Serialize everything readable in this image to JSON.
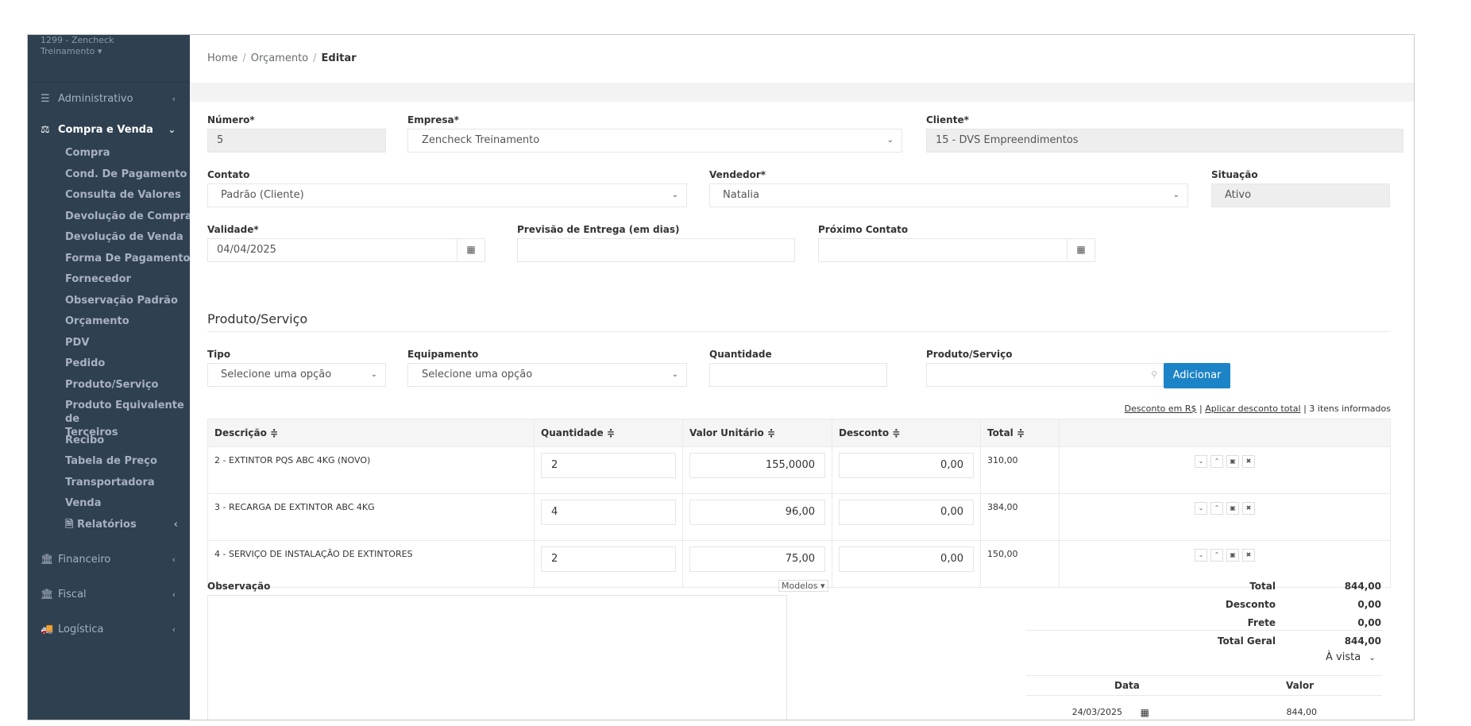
{
  "sidebar": {
    "user_line1": "1299 - Zencheck",
    "user_line2": "Treinamento ▾",
    "sections": {
      "administrativo": "Administrativo",
      "compra_venda": "Compra e Venda",
      "financeiro": "Financeiro",
      "fiscal": "Fiscal",
      "logistica": "Logística"
    },
    "items": [
      "Compra",
      "Cond. De Pagamento",
      "Consulta de Valores",
      "Devolução de Compra",
      "Devolução de Venda",
      "Forma De Pagamento",
      "Fornecedor",
      "Observação Padrão",
      "Orçamento",
      "PDV",
      "Pedido",
      "Produto/Serviço",
      "Produto Equivalente de",
      "Terceiros",
      "Recibo",
      "Tabela de Preço",
      "Transportadora",
      "Venda"
    ],
    "relatorios": "Relatórios"
  },
  "breadcrumb": {
    "home": "Home",
    "orcamento": "Orçamento",
    "editar": "Editar"
  },
  "form": {
    "numero_label": "Número*",
    "numero_value": "5",
    "empresa_label": "Empresa*",
    "empresa_value": "Zencheck Treinamento",
    "cliente_label": "Cliente*",
    "cliente_value": "15 - DVS Empreendimentos",
    "contato_label": "Contato",
    "contato_value": "Padrão (Cliente)",
    "vendedor_label": "Vendedor*",
    "vendedor_value": "Natalia",
    "situacao_label": "Situação",
    "situacao_value": "Ativo",
    "validade_label": "Validade*",
    "validade_value": "04/04/2025",
    "previsao_label": "Previsão de Entrega (em dias)",
    "proximo_label": "Próximo Contato"
  },
  "produto": {
    "title": "Produto/Serviço",
    "tipo_label": "Tipo",
    "tipo_value": "Selecione uma opção",
    "equip_label": "Equipamento",
    "equip_value": "Selecione uma opção",
    "qtd_label": "Quantidade",
    "prod_label": "Produto/Serviço",
    "add_button": "Adicionar"
  },
  "table_links": {
    "desconto": "Desconto em R$",
    "sep1": "|",
    "aplicar": "Aplicar desconto total",
    "sep2": "|",
    "info": "3 itens informados"
  },
  "table": {
    "headers": [
      "Descrição ≑",
      "Quantidade ≑",
      "Valor Unitário ≑",
      "Desconto ≑",
      "Total ≑"
    ],
    "rows": [
      {
        "desc": "2 - EXTINTOR PQS ABC 4KG (NOVO)",
        "qtd": "2",
        "unit": "155,0000",
        "desc_val": "0,00",
        "total": "310,00"
      },
      {
        "desc": "3 - RECARGA DE EXTINTOR ABC 4KG",
        "qtd": "4",
        "unit": "96,00",
        "desc_val": "0,00",
        "total": "384,00"
      },
      {
        "desc": "4 - SERVIÇO DE INSTALAÇÃO DE EXTINTORES",
        "qtd": "2",
        "unit": "75,00",
        "desc_val": "0,00",
        "total": "150,00"
      }
    ]
  },
  "obs": {
    "label": "Observação",
    "modelos": "Modelos ▾"
  },
  "totals": {
    "total_label": "Total",
    "total_value": "844,00",
    "desconto_label": "Desconto",
    "desconto_value": "0,00",
    "frete_label": "Frete",
    "frete_value": "0,00",
    "geral_label": "Total Geral",
    "geral_value": "844,00"
  },
  "pagamento": {
    "tipo": "À vista",
    "data_label": "Data",
    "valor_label": "Valor",
    "data_value": "24/03/2025",
    "valor_value": "844,00"
  }
}
